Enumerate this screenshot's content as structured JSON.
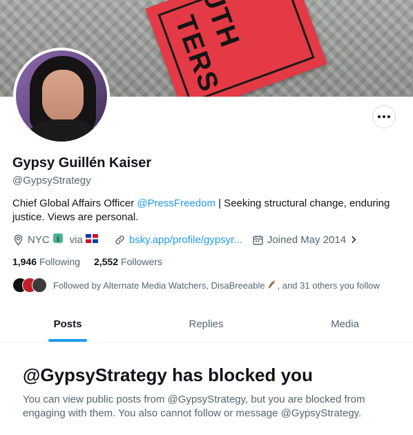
{
  "profile": {
    "name": "Gypsy Guillén Kaiser",
    "handle": "@GypsyStrategy",
    "bio": {
      "prefix": "Chief Global Affairs Officer ",
      "mention": "@PressFreedom",
      "suffix": " | Seeking structural change, enduring justice. Views are personal."
    },
    "location": "NYC",
    "location_via": "via",
    "website": "bsky.app/profile/gypsyr...",
    "joined": "Joined May 2014",
    "banner_text": [
      "UTH",
      "TERS"
    ]
  },
  "stats": {
    "following_count": "1,946",
    "following_label": "Following",
    "followers_count": "2,552",
    "followers_label": "Followers"
  },
  "followed_by": {
    "text": "Followed by Alternate Media Watchers, DisaBreeable",
    "suffix": ", and 31 others you follow"
  },
  "tabs": [
    {
      "label": "Posts",
      "active": true
    },
    {
      "label": "Replies",
      "active": false
    },
    {
      "label": "Media",
      "active": false
    }
  ],
  "blocked": {
    "title": "@GypsyStrategy has blocked you",
    "body": "You can view public posts from @GypsyStrategy, but you are blocked from engaging with them. You also cannot follow or message @GypsyStrategy."
  },
  "colors": {
    "accent": "#1d9bf0",
    "secondary_text": "#536471",
    "primary_text": "#0f1419"
  },
  "icons": [
    "location-icon",
    "statue-of-liberty-emoji",
    "dominican-flag-emoji",
    "link-icon",
    "calendar-icon",
    "chevron-right-icon",
    "more-icon",
    "feather-emoji"
  ]
}
